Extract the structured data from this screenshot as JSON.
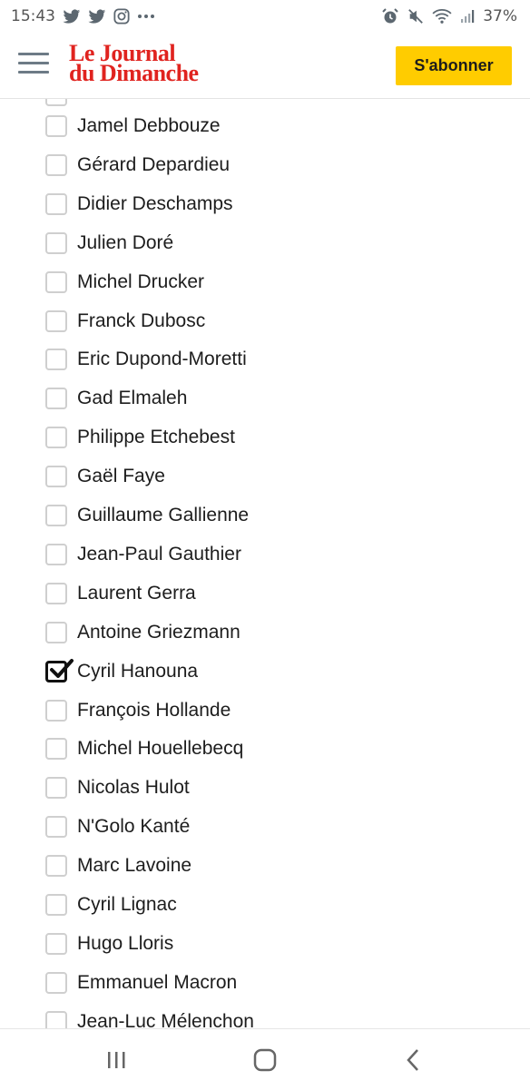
{
  "status_bar": {
    "time": "15:43",
    "battery": "37%",
    "left_icons": [
      "twitter-icon",
      "twitter-icon",
      "instagram-icon",
      "more-dots-icon"
    ],
    "right_icons": [
      "alarm-icon",
      "mute-icon",
      "wifi-icon",
      "signal-icon"
    ]
  },
  "header": {
    "logo_line1": "Le Journal",
    "logo_line2": "du Dimanche",
    "subscribe_label": "S'abonner",
    "brand_color": "#e0231f",
    "accent_color": "#ffcc00"
  },
  "list": {
    "items": [
      {
        "label": "Jamel Debbouze",
        "checked": false
      },
      {
        "label": "Gérard Depardieu",
        "checked": false
      },
      {
        "label": "Didier Deschamps",
        "checked": false
      },
      {
        "label": "Julien Doré",
        "checked": false
      },
      {
        "label": "Michel Drucker",
        "checked": false
      },
      {
        "label": "Franck Dubosc",
        "checked": false
      },
      {
        "label": "Eric Dupond-Moretti",
        "checked": false
      },
      {
        "label": "Gad Elmaleh",
        "checked": false
      },
      {
        "label": "Philippe Etchebest",
        "checked": false
      },
      {
        "label": "Gaël Faye",
        "checked": false
      },
      {
        "label": "Guillaume Gallienne",
        "checked": false
      },
      {
        "label": "Jean-Paul Gauthier",
        "checked": false
      },
      {
        "label": "Laurent Gerra",
        "checked": false
      },
      {
        "label": "Antoine Griezmann",
        "checked": false
      },
      {
        "label": "Cyril Hanouna",
        "checked": true
      },
      {
        "label": "François Hollande",
        "checked": false
      },
      {
        "label": "Michel Houellebecq",
        "checked": false
      },
      {
        "label": "Nicolas Hulot",
        "checked": false
      },
      {
        "label": "N'Golo Kanté",
        "checked": false
      },
      {
        "label": "Marc Lavoine",
        "checked": false
      },
      {
        "label": "Cyril Lignac",
        "checked": false
      },
      {
        "label": "Hugo Lloris",
        "checked": false
      },
      {
        "label": "Emmanuel Macron",
        "checked": false
      },
      {
        "label": "Jean-Luc Mélenchon",
        "checked": false
      }
    ]
  },
  "nav_bar": {
    "buttons": [
      "recent-apps-icon",
      "home-icon",
      "back-icon"
    ]
  }
}
